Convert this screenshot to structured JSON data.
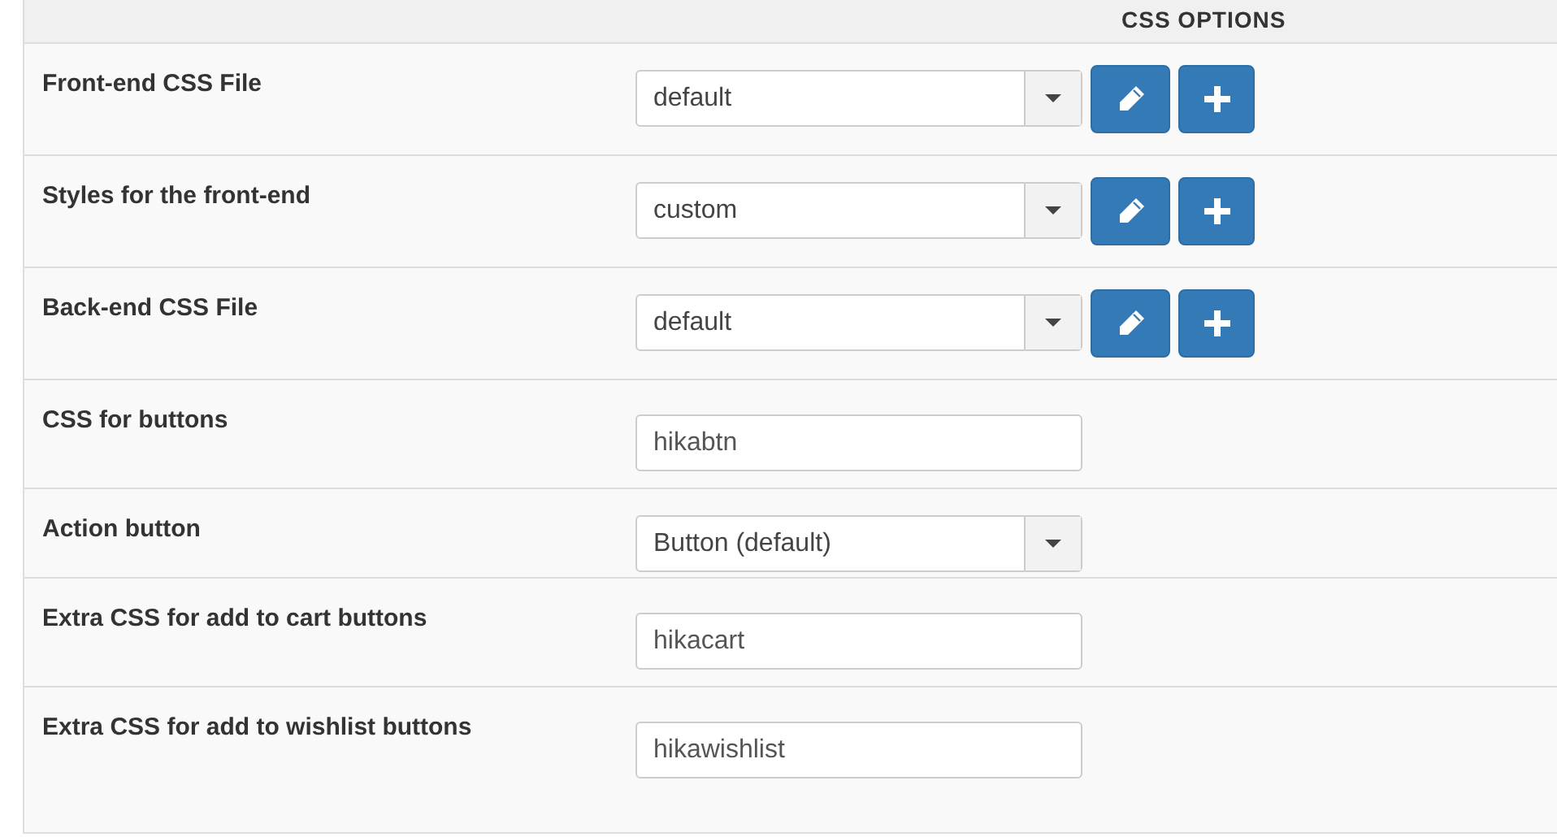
{
  "header": {
    "title": "CSS OPTIONS"
  },
  "rows": [
    {
      "label": "Front-end CSS File",
      "kind": "select_edit",
      "value": "default"
    },
    {
      "label": "Styles for the front-end",
      "kind": "select_edit",
      "value": "custom"
    },
    {
      "label": "Back-end CSS File",
      "kind": "select_edit",
      "value": "default"
    },
    {
      "label": "CSS for buttons",
      "kind": "text",
      "value": "hikabtn"
    },
    {
      "label": "Action button",
      "kind": "select",
      "value": "Button (default)"
    },
    {
      "label": "Extra CSS for add to cart buttons",
      "kind": "text",
      "value": "hikacart"
    },
    {
      "label": "Extra CSS for add to wishlist buttons",
      "kind": "text",
      "value": "hikawishlist"
    }
  ]
}
